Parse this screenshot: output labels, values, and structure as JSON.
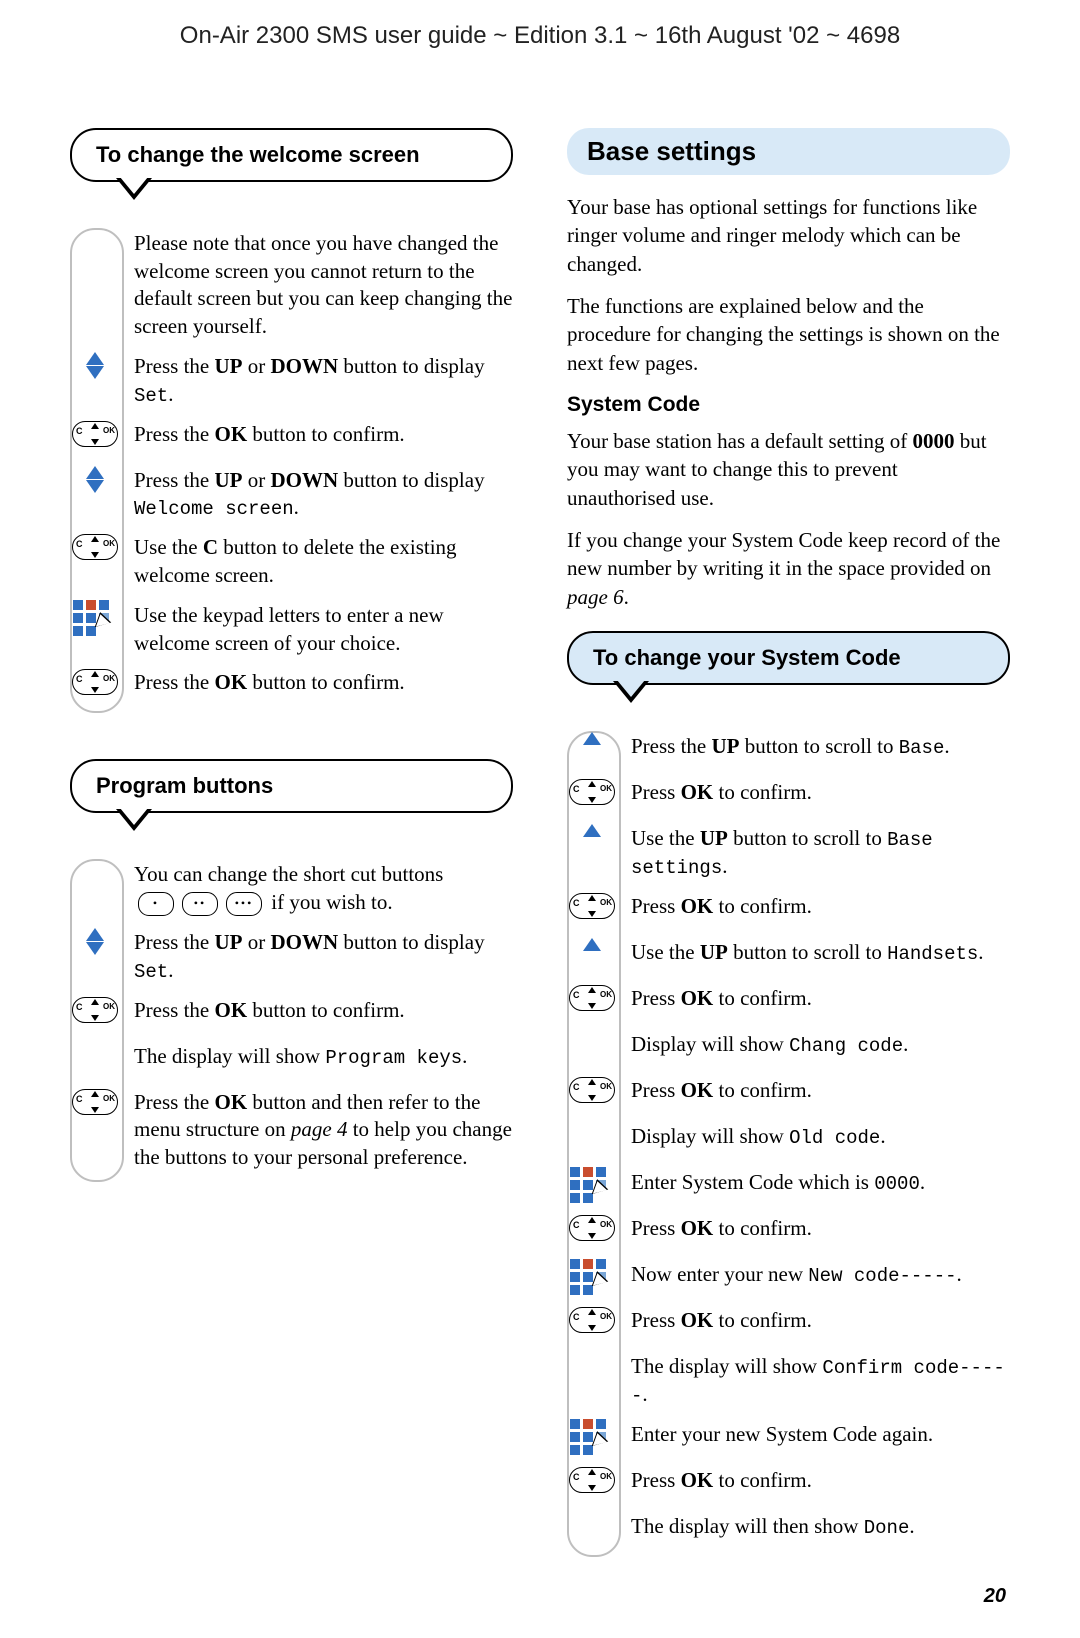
{
  "header": "On-Air 2300 SMS user guide ~ Edition 3.1 ~ 16th August '02 ~ 4698",
  "page_number": "20",
  "welcome": {
    "title": "To change the welcome screen",
    "note": "Please note that once you have changed the welcome screen you cannot return to the default screen but you can keep changing the screen yourself.",
    "steps": {
      "s1a": "Press the ",
      "s1b": "UP",
      "s1c": " or ",
      "s1d": "DOWN",
      "s1e": " button to display ",
      "s1m": "Set",
      "s1f": ".",
      "s2a": "Press the ",
      "s2b": "OK",
      "s2c": " button to confirm.",
      "s3a": "Press the ",
      "s3b": "UP",
      "s3c": " or ",
      "s3d": "DOWN",
      "s3e": " button to display ",
      "s3m": "Welcome screen",
      "s3f": ".",
      "s4a": "Use the ",
      "s4b": "C",
      "s4c": " button to delete the existing welcome screen.",
      "s5": "Use the keypad letters to enter a new welcome screen of your choice.",
      "s6a": "Press the ",
      "s6b": "OK",
      "s6c": " button to confirm."
    }
  },
  "program": {
    "title": "Program buttons",
    "intro_a": "You can change the short cut buttons ",
    "intro_b": " if you wish to.",
    "steps": {
      "s1a": "Press the ",
      "s1b": "UP",
      "s1c": " or ",
      "s1d": "DOWN",
      "s1e": " button to display ",
      "s1m": "Set",
      "s1f": ".",
      "s2a": "Press the ",
      "s2b": "OK",
      "s2c": " button to confirm.",
      "s3a": "The display will show ",
      "s3m": "Program keys",
      "s3b": ".",
      "s4a": "Press the ",
      "s4b": "OK",
      "s4c": " button and then refer to the menu structure on ",
      "s4pg": "page 4",
      "s4d": " to help you change the buttons to your personal preference."
    }
  },
  "base": {
    "heading": "Base settings",
    "p1": "Your base has optional settings for functions like ringer volume and ringer melody which can be changed.",
    "p2": "The functions are explained below and the procedure for changing the settings is shown on the next few pages.",
    "sc_head": "System Code",
    "sc1a": "Your base station has a default setting of ",
    "sc1b": "0000",
    "sc1c": " but you may want to change this to prevent unauthorised use.",
    "sc2a": "If you change your System Code keep record of the new number by writing it in the space provided on ",
    "sc2pg": "page 6",
    "sc2b": "."
  },
  "syscode": {
    "title": "To change your System Code",
    "steps": {
      "s1a": "Press the ",
      "s1b": "UP",
      "s1c": " button to scroll to ",
      "s1m": "Base",
      "s1d": ".",
      "s2a": "Press ",
      "s2b": "OK",
      "s2c": " to confirm.",
      "s3a": "Use the ",
      "s3b": "UP",
      "s3c": " button to scroll to ",
      "s3m": "Base settings",
      "s3d": ".",
      "s4a": "Press ",
      "s4b": "OK",
      "s4c": " to confirm.",
      "s5a": "Use the ",
      "s5b": "UP",
      "s5c": " button to scroll to ",
      "s5m": "Handsets",
      "s5d": ".",
      "s6a": "Press ",
      "s6b": "OK",
      "s6c": " to confirm.",
      "s7a": "Display will show ",
      "s7m": "Chang code",
      "s7b": ".",
      "s8a": "Press ",
      "s8b": "OK",
      "s8c": " to confirm.",
      "s9a": "Display will show ",
      "s9m": "Old code",
      "s9b": ".",
      "s10a": "Enter System Code which is ",
      "s10m": "0000",
      "s10b": ".",
      "s11a": "Press ",
      "s11b": "OK",
      "s11c": " to confirm.",
      "s12a": "Now enter your new ",
      "s12m": "New code-----",
      "s12b": ".",
      "s13a": "Press ",
      "s13b": "OK",
      "s13c": " to confirm.",
      "s14a": "The display will show ",
      "s14m": "Confirm code-----",
      "s14b": ".",
      "s15": "Enter your new System Code again.",
      "s16a": "Press ",
      "s16b": "OK",
      "s16c": " to confirm.",
      "s17a": "The display will then show ",
      "s17m": "Done",
      "s17b": "."
    }
  }
}
